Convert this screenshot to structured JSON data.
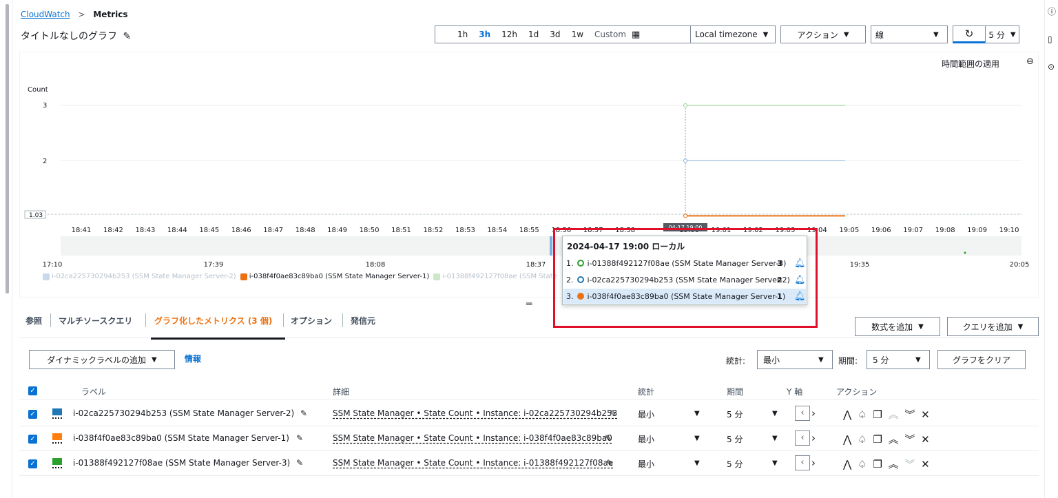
{
  "breadcrumb": {
    "root": "CloudWatch",
    "sep": ">",
    "current": "Metrics"
  },
  "graph_title": "タイトルなしのグラフ",
  "toolbar": {
    "ranges": [
      "1h",
      "3h",
      "12h",
      "1d",
      "3d",
      "1w",
      "Custom"
    ],
    "selected_range": "3h",
    "timezone": "Local timezone",
    "actions": "アクション",
    "graph_type": "線",
    "interval": "5 分"
  },
  "graph": {
    "zoom_apply": "時間範囲の適用",
    "y_unit": "Count",
    "y_ticks": [
      "3",
      "2"
    ],
    "y_min_label": "1.03",
    "x_ticks": [
      "18:41",
      "18:42",
      "18:43",
      "18:44",
      "18:45",
      "18:46",
      "18:47",
      "18:48",
      "18:49",
      "18:50",
      "18:51",
      "18:52",
      "18:53",
      "18:54",
      "18:55",
      "18:56",
      "18:57",
      "18:58",
      "18:59",
      "19:00",
      "19:01",
      "19:02",
      "19:03",
      "19:04",
      "19:05",
      "19:06",
      "19:07",
      "19:08",
      "19:09",
      "19:10"
    ],
    "cursor_time": "04-17 19:00",
    "overview_ticks": [
      "17:10",
      "17:39",
      "18:08",
      "18:37",
      "19:35",
      "20:05"
    ],
    "legend": [
      {
        "label": "i-02ca225730294b253 (SSM State Manager Server-2)",
        "color": "#c8d9ec",
        "faded": true
      },
      {
        "label": "i-038f4f0ae83c89ba0 (SSM State Manager Server-1)",
        "color": "#ec7211",
        "faded": false
      },
      {
        "label": "i-01388f492127f08ae (SSM State",
        "color": "#cde7c8",
        "faded": true
      }
    ]
  },
  "tooltip": {
    "title": "2024-04-17 19:00 ローカル",
    "rows": [
      {
        "index": "1.",
        "label": "i-01388f492127f08ae (SSM State Manager Server-3)",
        "value": "3",
        "color": "#2ca02c",
        "filled": false
      },
      {
        "index": "2.",
        "label": "i-02ca225730294b253 (SSM State Manager Server-2)",
        "value": "2",
        "color": "#1f77b4",
        "filled": false
      },
      {
        "index": "3.",
        "label": "i-038f4f0ae83c89ba0 (SSM State Manager Server-1)",
        "value": "1",
        "color": "#ec7211",
        "filled": true
      }
    ]
  },
  "tabs": [
    "参照",
    "マルチソースクエリ",
    "グラフ化したメトリクス (3 個)",
    "オプション",
    "発信元"
  ],
  "active_tab": "グラフ化したメトリクス (3 個)",
  "buttons": {
    "add_math": "数式を追加",
    "add_query": "クエリを追加",
    "add_dynamic_label": "ダイナミックラベルの追加",
    "info": "情報",
    "clear_graph": "グラフをクリア"
  },
  "filters": {
    "stat_label": "統計:",
    "stat_value": "最小",
    "period_label": "期間:",
    "period_value": "5 分"
  },
  "table": {
    "headers": {
      "label": "ラベル",
      "details": "詳細",
      "stat": "統計",
      "period": "期間",
      "yaxis": "Y 軸",
      "actions": "アクション"
    },
    "rows": [
      {
        "label": "i-02ca225730294b253 (SSM State Manager Server-2)",
        "details": "SSM State Manager • State Count • Instance: i-02ca225730294b253",
        "stat": "最小",
        "period": "5 分",
        "color": "#1f77b4"
      },
      {
        "label": "i-038f4f0ae83c89ba0 (SSM State Manager Server-1)",
        "details": "SSM State Manager • State Count • Instance: i-038f4f0ae83c89ba0",
        "stat": "最小",
        "period": "5 分",
        "color": "#ff7f0e"
      },
      {
        "label": "i-01388f492127f08ae (SSM State Manager Server-3)",
        "details": "SSM State Manager • State Count • Instance: i-01388f492127f08ae",
        "stat": "最小",
        "period": "5 分",
        "color": "#2ca02c"
      }
    ]
  },
  "chart_data": {
    "type": "line",
    "ylabel": "Count",
    "x": [
      "19:00",
      "19:05"
    ],
    "series": [
      {
        "name": "i-01388f492127f08ae (SSM State Manager Server-3)",
        "values": [
          3,
          3
        ]
      },
      {
        "name": "i-02ca225730294b253 (SSM State Manager Server-2)",
        "values": [
          2,
          2
        ]
      },
      {
        "name": "i-038f4f0ae83c89ba0 (SSM State Manager Server-1)",
        "values": [
          1,
          1
        ]
      }
    ]
  }
}
